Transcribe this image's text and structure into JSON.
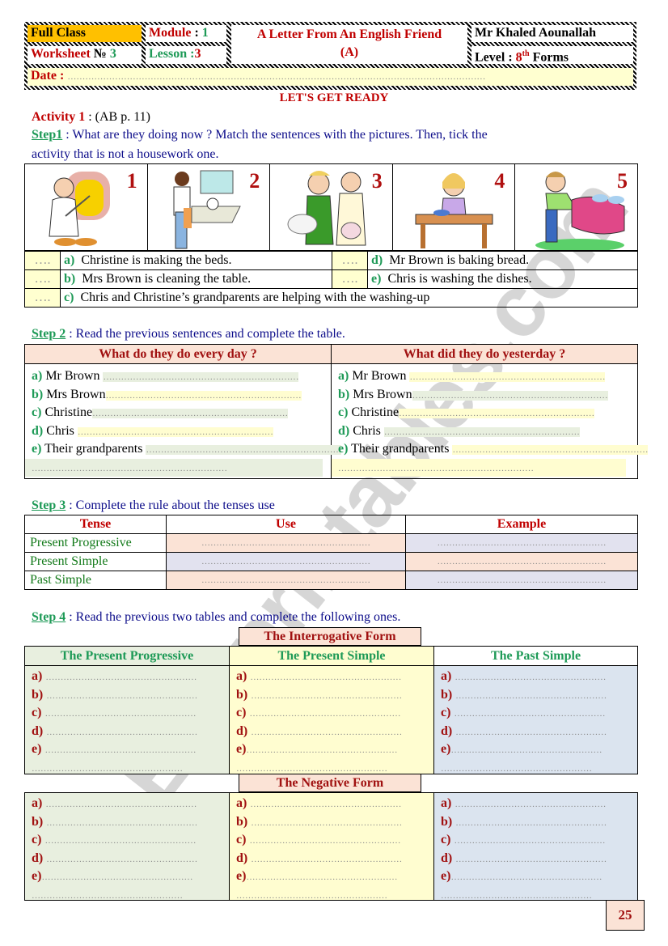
{
  "header": {
    "class_label": "Full Class",
    "module_label": "Module",
    "module_sep": " : ",
    "module_value": "1",
    "worksheet_label": "Worksheet",
    "worksheet_no": "№",
    "worksheet_value": "3",
    "lesson_label": "Lesson :",
    "lesson_value": "3",
    "title_line1": "A Letter From An English Friend",
    "title_line2": "(A)",
    "teacher": "Mr Khaled Aounallah",
    "level_label": "Level :",
    "level_value": "8",
    "level_sup": "th",
    "level_suffix": "Forms",
    "date_label": "Date :",
    "date_dots": "……………………………………………………………………………………………………………………………"
  },
  "section_title": "LET'S GET READY",
  "activity": {
    "label": "Activity 1",
    "ref": " : (AB p. 11)"
  },
  "step1": {
    "label": "Step1",
    "instruction_line1": " : What are they doing now ? Match the sentences with the pictures. Then, tick the",
    "instruction_line2": "activity that is not a housework one.",
    "pictures": [
      {
        "number": "1",
        "icon": "baker-baking-bread-icon"
      },
      {
        "number": "2",
        "icon": "man-washing-dishes-icon"
      },
      {
        "number": "3",
        "icon": "grandparents-washing-up-icon"
      },
      {
        "number": "4",
        "icon": "girl-cleaning-table-icon"
      },
      {
        "number": "5",
        "icon": "woman-making-bed-icon"
      }
    ],
    "answer_blank": "….",
    "sentences": [
      {
        "letter": "a)",
        "text": "Christine is making the beds."
      },
      {
        "letter": "b)",
        "text": "Mrs Brown is cleaning the table."
      },
      {
        "letter": "c)",
        "text": "Chris and Christine’s grandparents are helping with the washing-up"
      },
      {
        "letter": "d)",
        "text": "Mr Brown is baking bread."
      },
      {
        "letter": "e)",
        "text": "Chris is washing the dishes."
      }
    ]
  },
  "step2": {
    "label": "Step 2",
    "instruction": " : Read the previous sentences and complete the table.",
    "columns": [
      {
        "header": "What do they do every day ?"
      },
      {
        "header": "What did they do yesterday ?"
      }
    ],
    "rows": [
      {
        "letter": "a)",
        "subject": "Mr Brown"
      },
      {
        "letter": "b)",
        "subject": "Mrs Brown"
      },
      {
        "letter": "c)",
        "subject": "Christine"
      },
      {
        "letter": "d)",
        "subject": "Chris"
      },
      {
        "letter": "e)",
        "subject": "Their grandparents"
      }
    ],
    "dots": "…………………………………………………………"
  },
  "step3": {
    "label": "Step 3",
    "instruction": " : Complete the rule about the tenses use",
    "headers": [
      "Tense",
      "Use",
      "Example"
    ],
    "tenses": [
      "Present Progressive",
      "Present Simple",
      "Past Simple"
    ],
    "dots": "…………………………………………………"
  },
  "step4": {
    "label": "Step 4",
    "instruction": " : Read the previous two tables and complete the following ones.",
    "interrogative_label": "The Interrogative Form",
    "negative_label": "The Negative Form",
    "columns": [
      "The Present Progressive",
      "The Present Simple",
      "The Past Simple"
    ],
    "letters": [
      "a)",
      "b)",
      "c)",
      "d)",
      "e)"
    ],
    "dots": "……………………………………………"
  },
  "page_number": "25",
  "watermark": "ESLprintables.com"
}
